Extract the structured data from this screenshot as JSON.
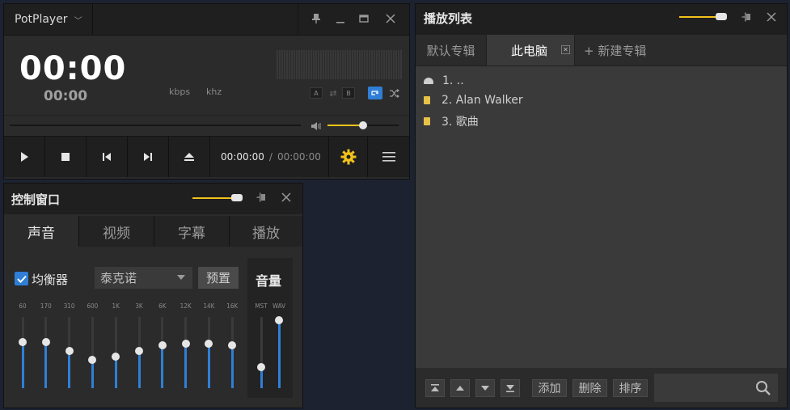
{
  "player": {
    "title": "PotPlayer",
    "time_main": "00:00",
    "time_sub": "00:00",
    "kbps": "kbps",
    "khz": "khz",
    "btn_a": "A",
    "btn_b": "B",
    "time_current": "00:00:00",
    "time_slash": "/",
    "time_total": "00:00:00",
    "volume_level": 0.5,
    "colors": {
      "accent": "#f2c21a",
      "repeat": "#2f7fd6"
    }
  },
  "control": {
    "title": "控制窗口",
    "tabs": [
      "声音",
      "视频",
      "字幕",
      "播放"
    ],
    "active_tab": 0,
    "eq_checkbox_label": "均衡器",
    "eq_preset": "泰克诺",
    "preset_button": "预置",
    "volume_title": "音量",
    "bands": [
      {
        "label": "60",
        "level": 0.65
      },
      {
        "label": "170",
        "level": 0.65
      },
      {
        "label": "310",
        "level": 0.52
      },
      {
        "label": "600",
        "level": 0.4
      },
      {
        "label": "1K",
        "level": 0.44
      },
      {
        "label": "3K",
        "level": 0.52
      },
      {
        "label": "6K",
        "level": 0.6
      },
      {
        "label": "12K",
        "level": 0.63
      },
      {
        "label": "14K",
        "level": 0.63
      },
      {
        "label": "16K",
        "level": 0.6
      }
    ],
    "volume_bands": [
      {
        "label": "MST",
        "level": 0.3
      },
      {
        "label": "WAV",
        "level": 0.95
      }
    ]
  },
  "playlist": {
    "title": "播放列表",
    "tabs": [
      "默认专辑",
      "此电脑"
    ],
    "new_tab": "+ 新建专辑",
    "items": [
      "1. ..",
      "2. Alan Walker",
      "3. 歌曲"
    ],
    "buttons": {
      "add": "添加",
      "delete": "删除",
      "sort": "排序"
    }
  }
}
